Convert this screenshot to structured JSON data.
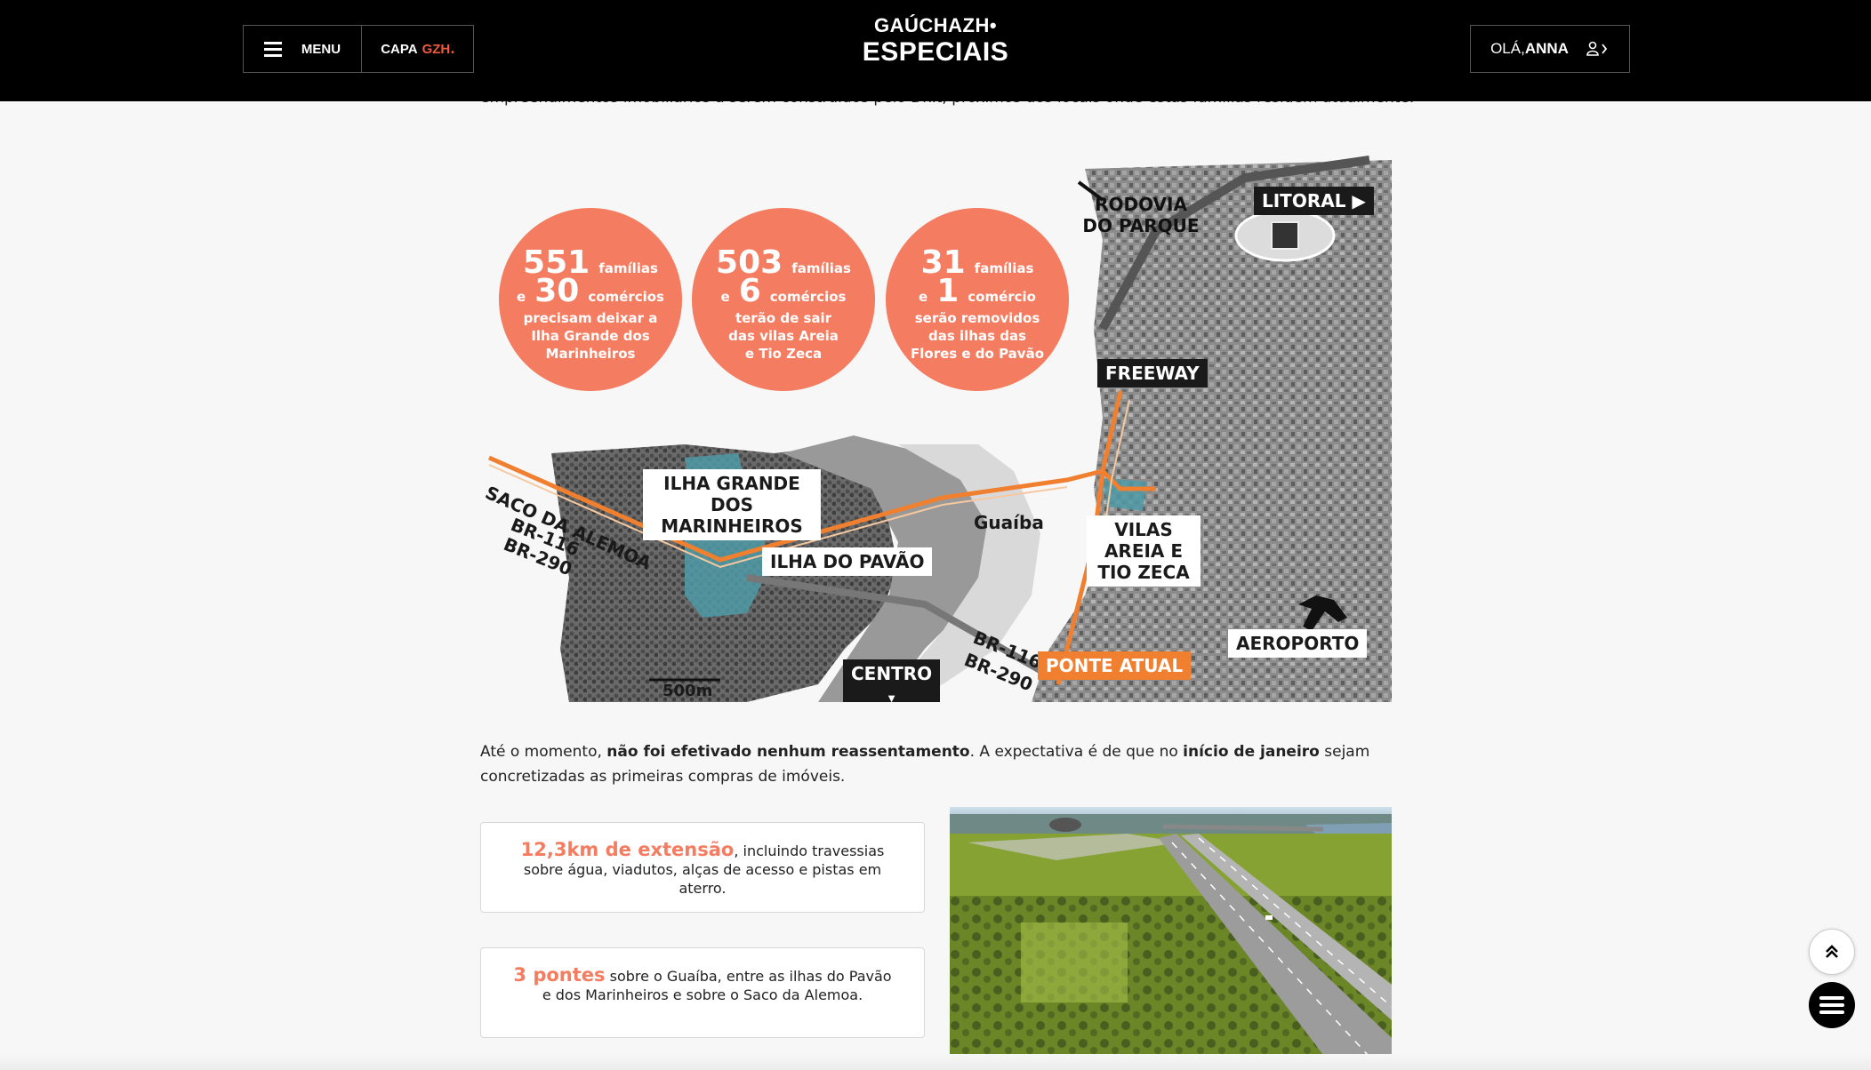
{
  "header": {
    "menu_label": "MENU",
    "capa_label": "CAPA",
    "capa_brand": "GZH",
    "capa_dot": "•",
    "logo_top": "GAÚCHAZH•",
    "logo_bottom": "ESPECIAIS",
    "greeting": "OLÁ,",
    "user_name": "ANNA"
  },
  "intro_cut_text": "empreendimentos imobiliários a serem construídos pelo Dnit, próximos dos locais onde estas famílias residem atualmente.",
  "map": {
    "circles": [
      {
        "n1": "551",
        "t1": "famílias",
        "conj": "e",
        "n2": "30",
        "t2": "comércios",
        "desc": "precisam deixar a Ilha Grande dos Marinheiros"
      },
      {
        "n1": "503",
        "t1": "famílias",
        "conj": "e",
        "n2": "6",
        "t2": "comércios",
        "desc": "terão de sair das vilas Areia e Tio Zeca"
      },
      {
        "n1": "31",
        "t1": "famílias",
        "conj": "e",
        "n2": "1",
        "t2": "comércio",
        "desc": "serão removidos das ilhas das Flores e do Pavão"
      }
    ],
    "labels": {
      "rodovia": "RODOVIA DO PARQUE",
      "litoral": "LITORAL",
      "freeway": "FREEWAY",
      "ilha_grande": "ILHA GRANDE DOS MARINHEIROS",
      "saco": "SACO DA ALEMOA",
      "br116_left": "BR-116",
      "br290_left": "BR-290",
      "ilha_pavao": "ILHA DO PAVÃO",
      "guaiba": "Guaíba",
      "vilas": "VILAS AREIA E TIO ZECA",
      "aeroporto": "AEROPORTO",
      "br116_right": "BR-116",
      "br290_right": "BR-290",
      "ponte": "PONTE ATUAL",
      "centro": "CENTRO",
      "scale": "500m"
    }
  },
  "paragraph": {
    "p1": "Até o momento, ",
    "b1": "não foi efetivado nenhum reassentamento",
    "p2": ". A expectativa é de que no ",
    "b2": "início de janeiro",
    "p3": " sejam concretizadas as primeiras compras de imóveis."
  },
  "facts": [
    {
      "highlight": "12,3km de extensão",
      "text": ", incluindo travessias sobre água, viadutos, alças de acesso e pistas em aterro."
    },
    {
      "highlight": "3 pontes",
      "text": " sobre o Guaíba, entre as ilhas do Pavão e dos Marinheiros e sobre o Saco da Alemoa."
    }
  ],
  "icons": {
    "hamburger": "hamburger-icon",
    "user": "user-icon",
    "scroll_top": "double-chevron-up-icon",
    "menu_fab": "menu-icon"
  },
  "colors": {
    "accent": "#f47c60",
    "brand_red": "#f05a3c",
    "header_bg": "#000000"
  }
}
